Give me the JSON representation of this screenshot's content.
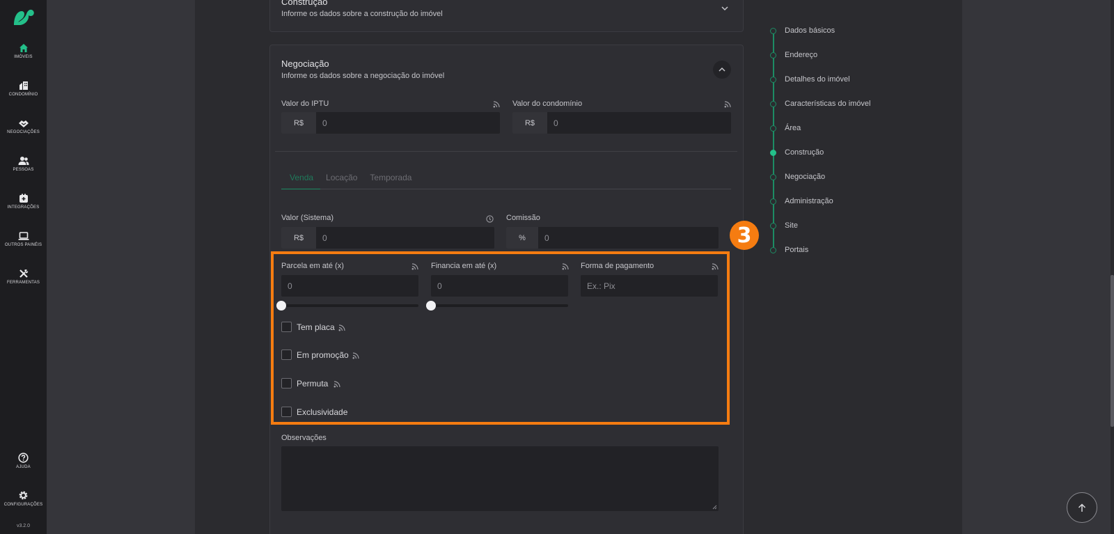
{
  "sidebar": {
    "items": [
      {
        "id": "imoveis",
        "label": "IMÓVEIS",
        "icon": "home-icon"
      },
      {
        "id": "condominio",
        "label": "CONDOMÍNIO",
        "icon": "building-icon"
      },
      {
        "id": "negociacoes",
        "label": "NEGOCIAÇÕES",
        "icon": "handshake-icon"
      },
      {
        "id": "pessoas",
        "label": "PESSOAS",
        "icon": "people-icon"
      },
      {
        "id": "integracoes",
        "label": "INTEGRAÇÕES",
        "icon": "integration-icon"
      },
      {
        "id": "outros-paineis",
        "label": "OUTROS PAINÉIS",
        "icon": "laptop-icon"
      },
      {
        "id": "ferramentas",
        "label": "FERRAMENTAS",
        "icon": "tools-icon"
      }
    ],
    "bottom": [
      {
        "id": "ajuda",
        "label": "AJUDA",
        "icon": "help-icon"
      },
      {
        "id": "configuracoes",
        "label": "CONFIGURAÇÕES",
        "icon": "gear-icon"
      }
    ],
    "version": "v3.2.0"
  },
  "construcao": {
    "title": "Construção",
    "subtitle": "Informe os dados sobre a construção do imóvel"
  },
  "negociacao": {
    "title": "Negociação",
    "subtitle": "Informe os dados sobre a negociação do imóvel",
    "iptu": {
      "label": "Valor do IPTU",
      "prefix": "R$",
      "value": "0"
    },
    "condominio": {
      "label": "Valor do condomínio",
      "prefix": "R$",
      "value": "0"
    },
    "tabs": [
      "Venda",
      "Locação",
      "Temporada"
    ],
    "active_tab": "Venda",
    "valor_sistema": {
      "label": "Valor (Sistema)",
      "prefix": "R$",
      "value": "0"
    },
    "comissao": {
      "label": "Comissão",
      "prefix": "%",
      "value": "0"
    },
    "parcela": {
      "label": "Parcela em até (x)",
      "value": "0",
      "slider": 0
    },
    "financia": {
      "label": "Financia em até (x)",
      "value": "0",
      "slider": 0
    },
    "forma_pagamento": {
      "label": "Forma de pagamento",
      "placeholder": "Ex.: Pix"
    },
    "checkboxes": [
      {
        "label": "Tem placa",
        "checked": false
      },
      {
        "label": "Em promoção",
        "checked": false
      },
      {
        "label": "Permuta",
        "checked": false
      },
      {
        "label": "Exclusividade",
        "checked": false
      }
    ],
    "observacoes": {
      "label": "Observações",
      "value": ""
    }
  },
  "annotation": {
    "badge": "3",
    "color": "#f57c11"
  },
  "stepper": {
    "steps": [
      "Dados básicos",
      "Endereço",
      "Detalhes do imóvel",
      "Características do imóvel",
      "Área",
      "Construção",
      "Negociação",
      "Administração",
      "Site",
      "Portais"
    ],
    "current": "Construção"
  },
  "colors": {
    "accent": "#1c8c64",
    "accent_dot": "#24c08a",
    "highlight": "#f57c11"
  }
}
